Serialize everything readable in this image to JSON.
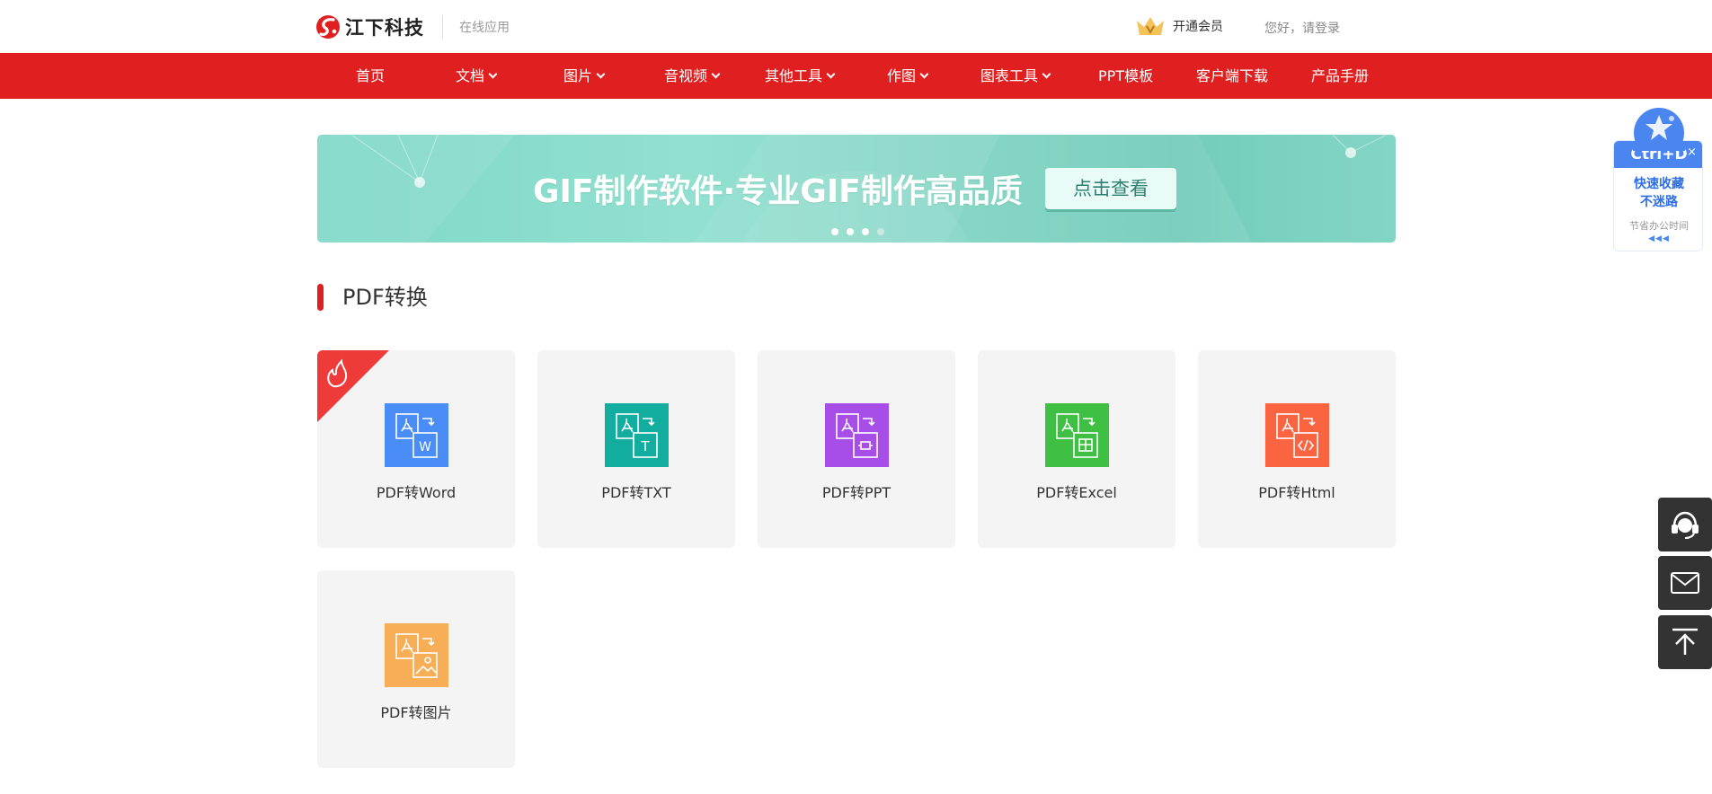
{
  "header": {
    "brand": "江下科技",
    "subtitle": "在线应用",
    "vip_label": "开通会员",
    "login_label": "您好，请登录"
  },
  "nav": {
    "items": [
      {
        "label": "首页",
        "dropdown": false
      },
      {
        "label": "文档",
        "dropdown": true
      },
      {
        "label": "图片",
        "dropdown": true
      },
      {
        "label": "音视频",
        "dropdown": true
      },
      {
        "label": "其他工具",
        "dropdown": true
      },
      {
        "label": "作图",
        "dropdown": true
      },
      {
        "label": "图表工具",
        "dropdown": true
      },
      {
        "label": "PPT模板",
        "dropdown": false
      },
      {
        "label": "客户端下载",
        "dropdown": false
      },
      {
        "label": "产品手册",
        "dropdown": false
      }
    ]
  },
  "banner": {
    "title": "GIF制作软件·专业GIF制作高品质",
    "button": "点击查看",
    "slides": 4,
    "active_slide": 3
  },
  "section": {
    "title": "PDF转换"
  },
  "tools": [
    {
      "label": "PDF转Word",
      "color": "#4a8df6",
      "glyph": "W",
      "hot": true
    },
    {
      "label": "PDF转TXT",
      "color": "#12ad9f",
      "glyph": "T",
      "hot": false
    },
    {
      "label": "PDF转PPT",
      "color": "#a84ee8",
      "glyph": "ppt",
      "hot": false
    },
    {
      "label": "PDF转Excel",
      "color": "#3fbf43",
      "glyph": "grid",
      "hot": false
    },
    {
      "label": "PDF转Html",
      "color": "#fa6441",
      "glyph": "code",
      "hot": false
    },
    {
      "label": "PDF转图片",
      "color": "#f7ae57",
      "glyph": "image",
      "hot": false
    }
  ],
  "float": {
    "shortcut": "Ctrl+D",
    "close": "×",
    "main_line1": "快速收藏",
    "main_line2": "不迷路",
    "sub": "节省办公时间",
    "arrows": "◀◀◀"
  },
  "colors": {
    "primary": "#e02020",
    "banner": "#86d6c6",
    "card_bg": "#f4f4f4",
    "side_btn": "#333333"
  }
}
